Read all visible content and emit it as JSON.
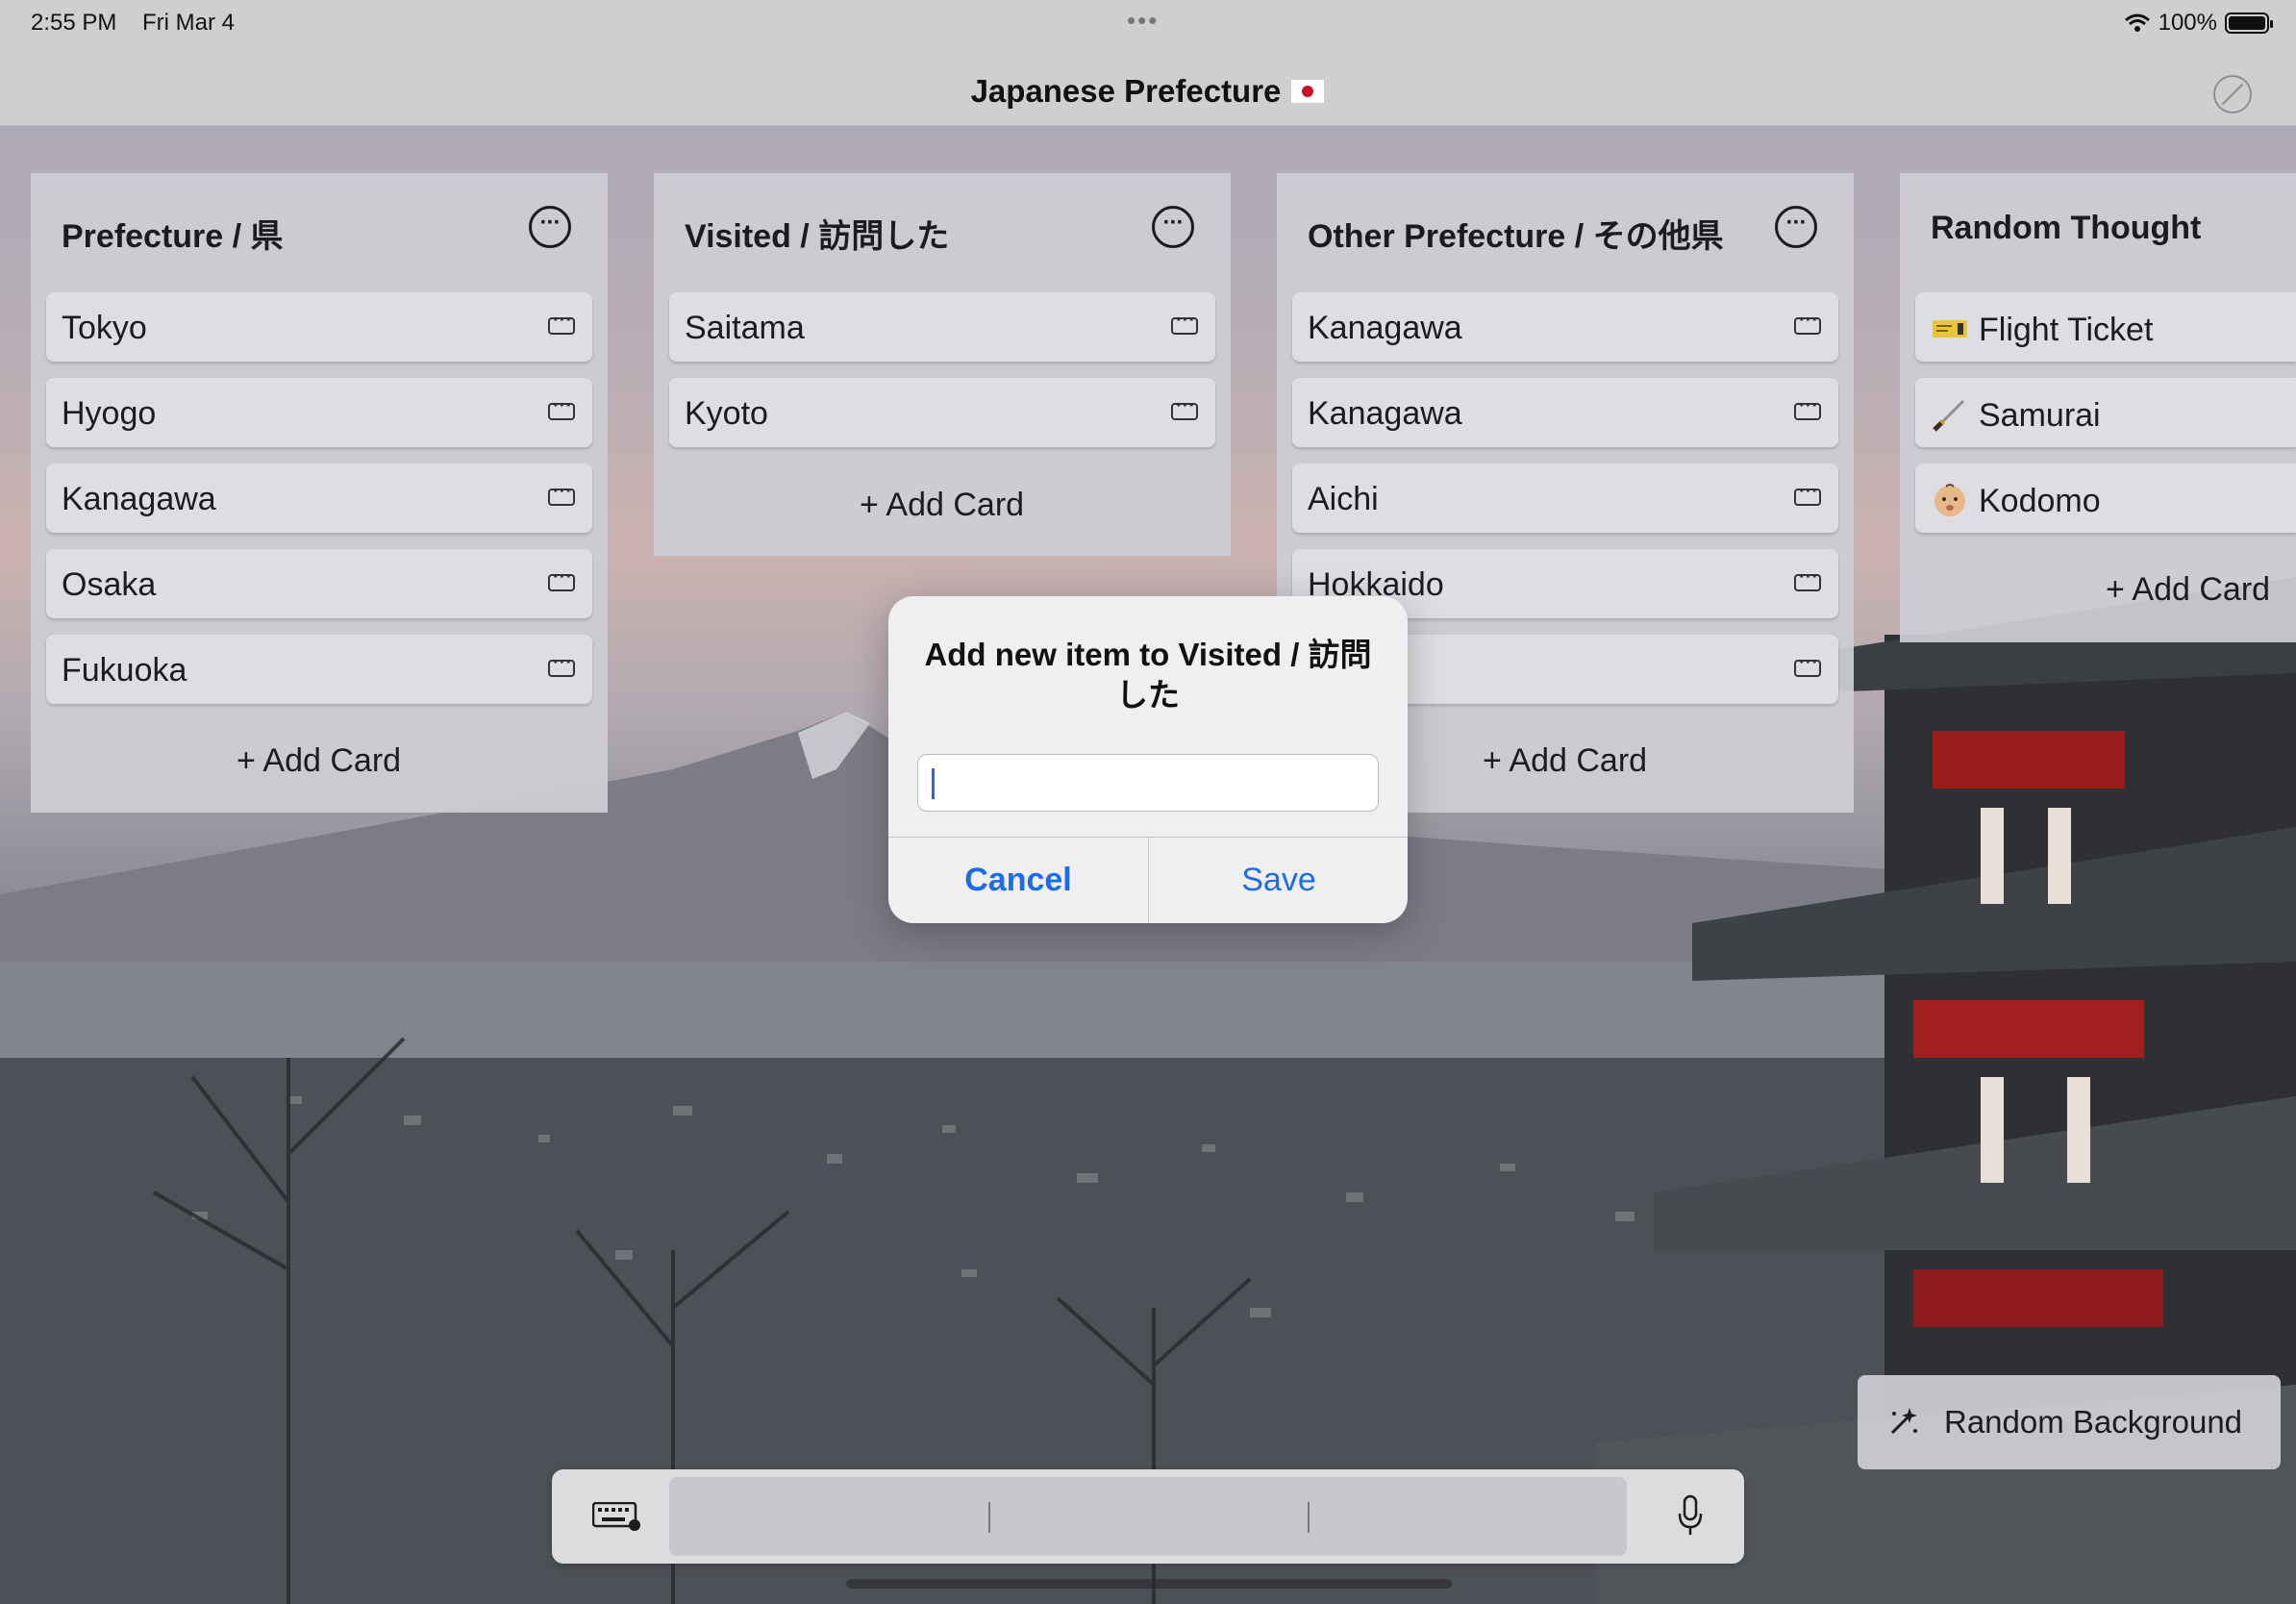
{
  "status_bar": {
    "time": "2:55 PM",
    "date": "Fri Mar 4",
    "battery": "100%"
  },
  "nav": {
    "title": "Japanese Prefecture"
  },
  "lists": [
    {
      "title": "Prefecture / 県",
      "cards": [
        "Tokyo",
        "Hyogo",
        "Kanagawa",
        "Osaka",
        "Fukuoka"
      ],
      "add_label": "+ Add Card"
    },
    {
      "title": "Visited / 訪問した",
      "cards": [
        "Saitama",
        "Kyoto"
      ],
      "add_label": "+ Add Card"
    },
    {
      "title": "Other Prefecture / その他県",
      "cards": [
        "Kanagawa",
        "Kanagawa",
        "Aichi",
        "Hokkaido",
        ""
      ],
      "add_label": "+ Add Card"
    },
    {
      "title": "Random Thought",
      "cards": [
        "Flight Ticket",
        "Samurai",
        "Kodomo"
      ],
      "add_label": "+ Add Card"
    }
  ],
  "alert": {
    "title": "Add new item to Visited / 訪問した",
    "input_value": "",
    "cancel_label": "Cancel",
    "save_label": "Save"
  },
  "random_bg": {
    "label": "Random Background"
  },
  "colors": {
    "accent": "#1c6be8",
    "list_bg": "#cecece",
    "card_bg": "#dedee2"
  }
}
